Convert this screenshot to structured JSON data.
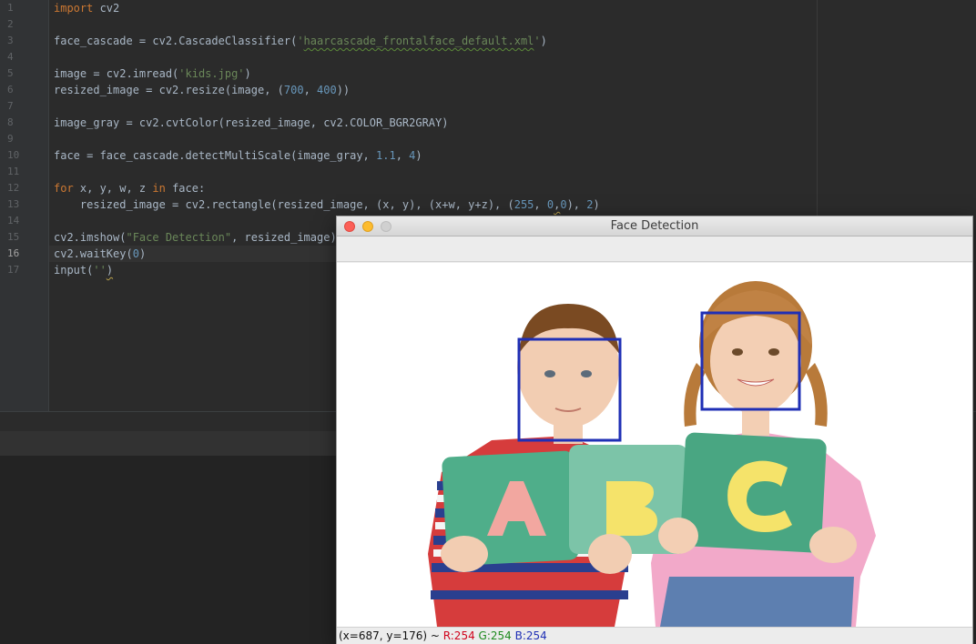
{
  "editor": {
    "line_numbers": [
      "1",
      "2",
      "3",
      "4",
      "5",
      "6",
      "7",
      "8",
      "9",
      "10",
      "11",
      "12",
      "13",
      "14",
      "15",
      "16",
      "17"
    ],
    "lines": {
      "l1": {
        "kw": "import",
        "rest": " cv2"
      },
      "l3": {
        "a": "face_cascade = cv2.CascadeClassifier(",
        "q1": "'",
        "s": "haarcascade_frontalface_default.xml",
        "q2": "'",
        "b": ")"
      },
      "l5": {
        "a": "image = cv2.imread(",
        "s": "'kids.jpg'",
        "b": ")"
      },
      "l6": {
        "a": "resized_image = cv2.resize(image, (",
        "n1": "700",
        "c": ", ",
        "n2": "400",
        "b": "))"
      },
      "l8": {
        "a": "image_gray = cv2.cvtColor(resized_image, cv2.COLOR_BGR2GRAY)"
      },
      "l10": {
        "a": "face = face_cascade.detectMultiScale(image_gray, ",
        "n1": "1.1",
        "c": ", ",
        "n2": "4",
        "b": ")"
      },
      "l12": {
        "kw1": "for",
        "a": " x, y, w, z ",
        "kw2": "in",
        "b": " face:"
      },
      "l13": {
        "a": "    resized_image = cv2.rectangle(resized_image, (x, y), (x+w, y+z), (",
        "n1": "255",
        "c1": ", ",
        "n2": "0",
        "c2": ",",
        "n3": "0",
        "c3": "), ",
        "n4": "2",
        "b": ")"
      },
      "l15": {
        "a": "cv2.imshow(",
        "s": "\"Face Detection\"",
        "b": ", resized_image)"
      },
      "l16": {
        "a": "cv2.waitKey(",
        "n1": "0",
        "b": ")"
      },
      "l17": {
        "a": "input(",
        "s": "''",
        "b": ")"
      }
    }
  },
  "window": {
    "title": "Face Detection",
    "status": {
      "coords": "(x=687, y=176) ~ ",
      "r": "R:254",
      "g": "G:254",
      "b": "B:254"
    }
  },
  "colors": {
    "detection_box": "#1f2fb5",
    "boy_shirt": "#d43b3b",
    "girl_shirt": "#f0a6c8",
    "puzzle": "#4fae8a"
  },
  "icons": [
    "close-icon",
    "minimize-icon",
    "maximize-icon"
  ]
}
